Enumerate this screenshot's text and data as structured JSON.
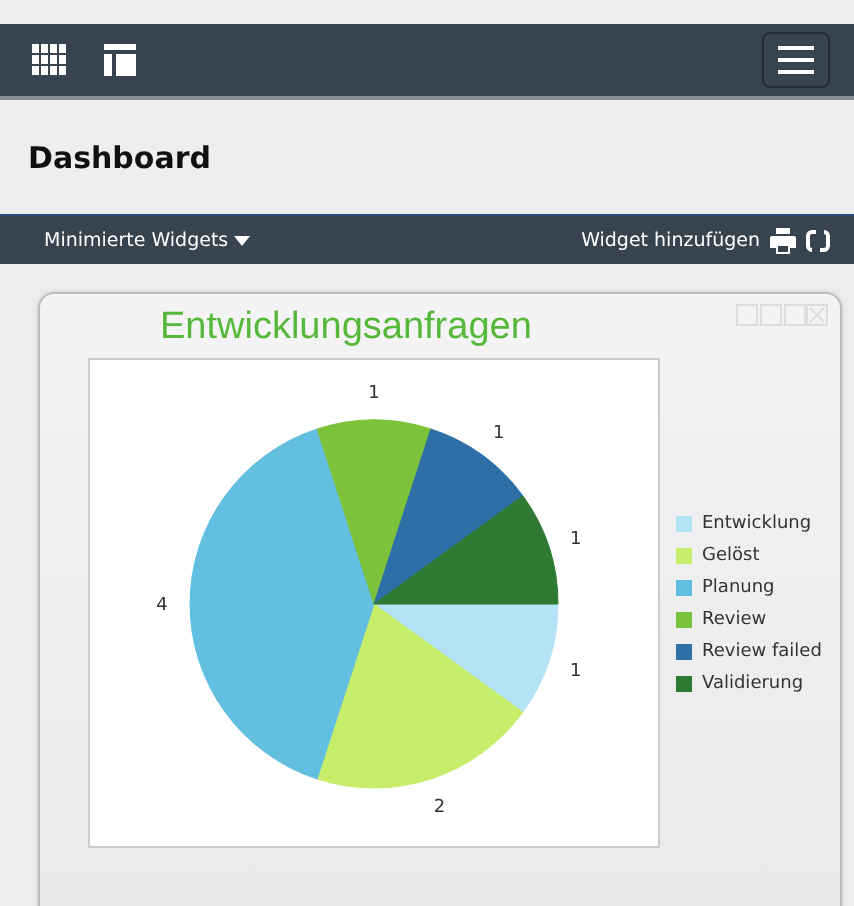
{
  "header": {
    "title": "Dashboard"
  },
  "toolbar": {
    "minimized_label": "Minimierte Widgets",
    "add_label": "Widget hinzufügen"
  },
  "widget": {
    "title": "Entwicklungsanfragen",
    "chart_data": {
      "type": "pie",
      "categories": [
        "Entwicklung",
        "Gelöst",
        "Planung",
        "Review",
        "Review failed",
        "Validierung"
      ],
      "values": [
        1,
        2,
        4,
        1,
        1,
        1
      ],
      "colors": [
        "#b4e3f5",
        "#c6ee6a",
        "#62bfe0",
        "#7cc23a",
        "#2e6fa8",
        "#2f7a32"
      ],
      "data_labels": true
    }
  }
}
